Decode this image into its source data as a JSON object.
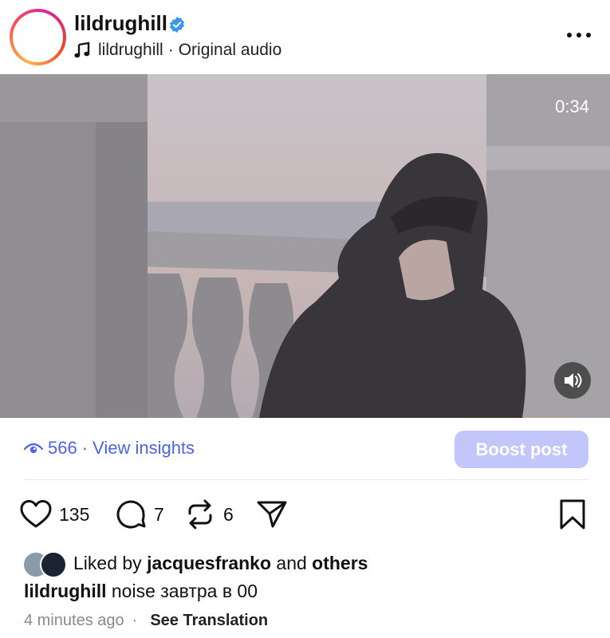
{
  "header": {
    "username": "lildrughill",
    "audio_author": "lildrughill",
    "audio_separator": "·",
    "audio_title": "Original audio",
    "icons": [
      "verified-badge-icon",
      "music-note-icon",
      "more-options-icon"
    ]
  },
  "video": {
    "duration": "0:34",
    "sound_icon": "speaker-icon"
  },
  "insights": {
    "views": "566",
    "separator": "·",
    "link_label": "View insights",
    "boost_label": "Boost post"
  },
  "actions": {
    "likes": "135",
    "comments": "7",
    "reposts": "6"
  },
  "liked_by": {
    "prefix": "Liked by",
    "user": "jacquesfranko",
    "conjunction": "and",
    "others": "others"
  },
  "caption": {
    "username": "lildrughill",
    "text": "noise завтра в 00"
  },
  "meta": {
    "time": "4 minutes ago",
    "separator": "·",
    "translate_label": "See Translation"
  },
  "colors": {
    "accent": "#4b63ea",
    "boost_bg": "#c2c6fb",
    "verified": "#3897f0"
  }
}
